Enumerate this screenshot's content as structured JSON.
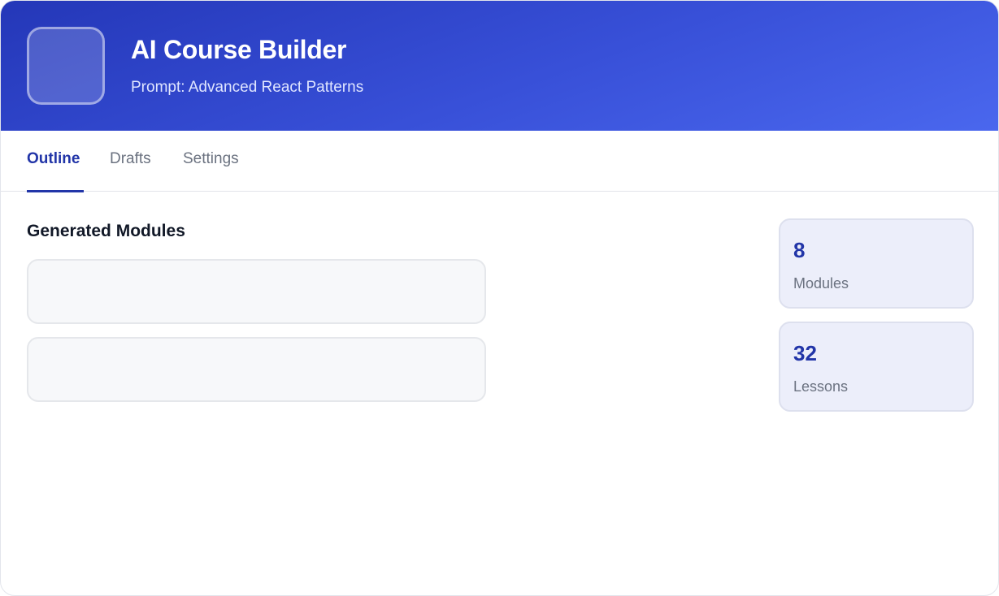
{
  "header": {
    "title": "AI Course Builder",
    "subtitle": "Prompt: Advanced React Patterns"
  },
  "tabs": [
    {
      "label": "Outline",
      "active": true
    },
    {
      "label": "Drafts",
      "active": false
    },
    {
      "label": "Settings",
      "active": false
    }
  ],
  "main": {
    "section_title": "Generated Modules",
    "modules": [
      {
        "title": ""
      },
      {
        "title": ""
      }
    ]
  },
  "stats": [
    {
      "value": "8",
      "label": "Modules"
    },
    {
      "value": "32",
      "label": "Lessons"
    }
  ],
  "colors": {
    "accent": "#2235a8",
    "header_gradient_start": "#2437b8",
    "header_gradient_end": "#4a67ee"
  }
}
